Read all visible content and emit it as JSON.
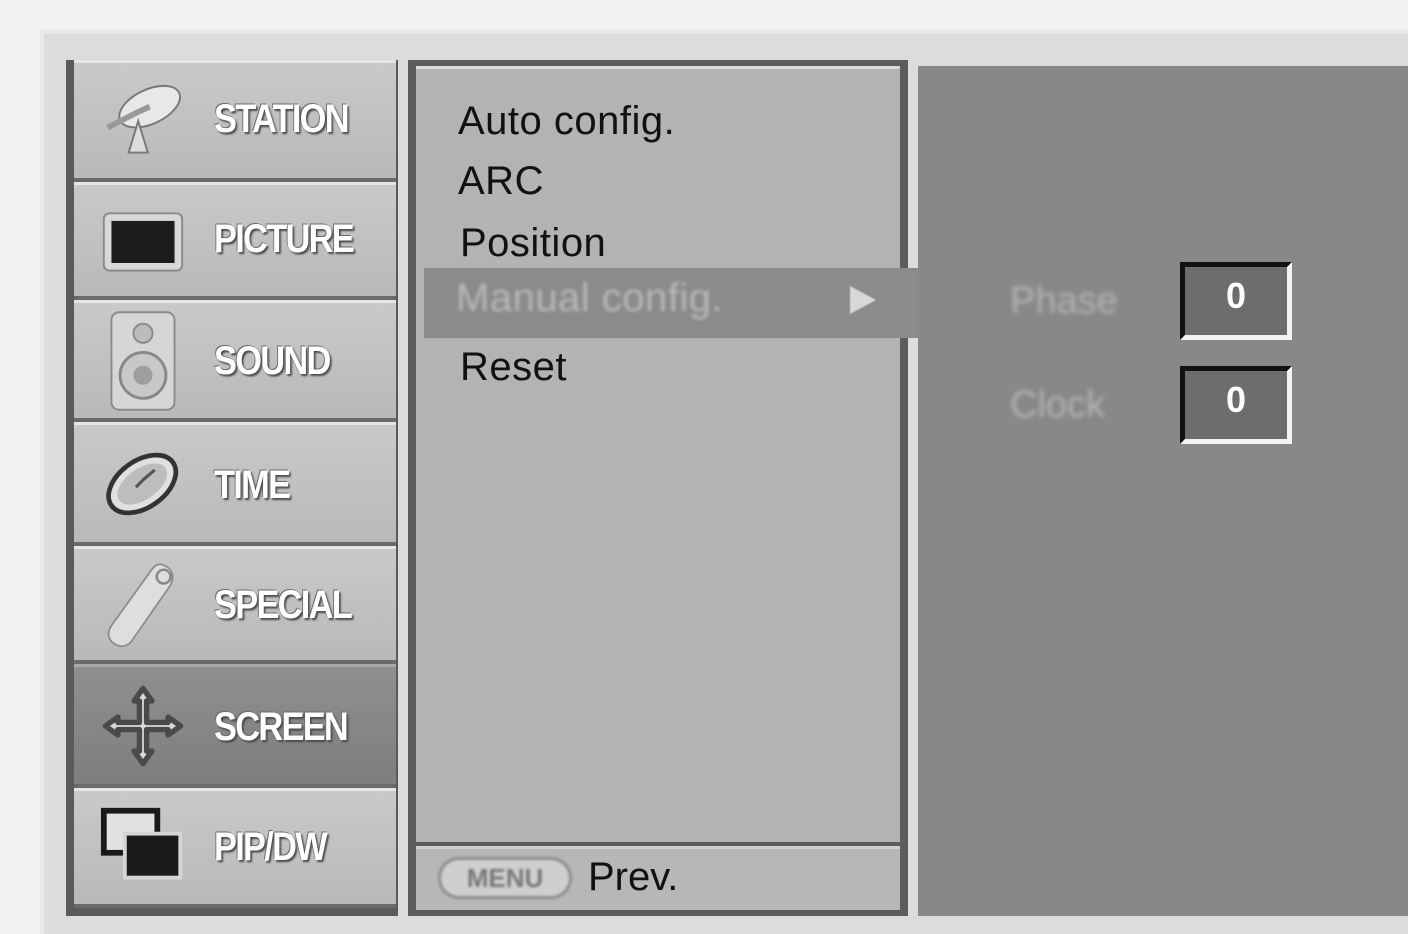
{
  "sidebar": {
    "items": [
      {
        "label": "STATION",
        "icon": "satellite-dish-icon"
      },
      {
        "label": "PICTURE",
        "icon": "tv-screen-icon"
      },
      {
        "label": "SOUND",
        "icon": "speaker-icon"
      },
      {
        "label": "TIME",
        "icon": "clock-icon"
      },
      {
        "label": "SPECIAL",
        "icon": "remote-control-icon"
      },
      {
        "label": "SCREEN",
        "icon": "move-arrows-icon"
      },
      {
        "label": "PIP/DW",
        "icon": "pip-windows-icon"
      }
    ],
    "active": "SCREEN"
  },
  "submenu": {
    "items": [
      {
        "label": "Auto config."
      },
      {
        "label": "ARC"
      },
      {
        "label": "Position"
      },
      {
        "label": "Manual config."
      },
      {
        "label": "Reset"
      }
    ],
    "selected": "Manual config."
  },
  "footer": {
    "menu_key": "MENU",
    "prev_label": "Prev."
  },
  "params": {
    "phase": {
      "label": "Phase",
      "value": "0"
    },
    "clock": {
      "label": "Clock",
      "value": "0"
    }
  }
}
